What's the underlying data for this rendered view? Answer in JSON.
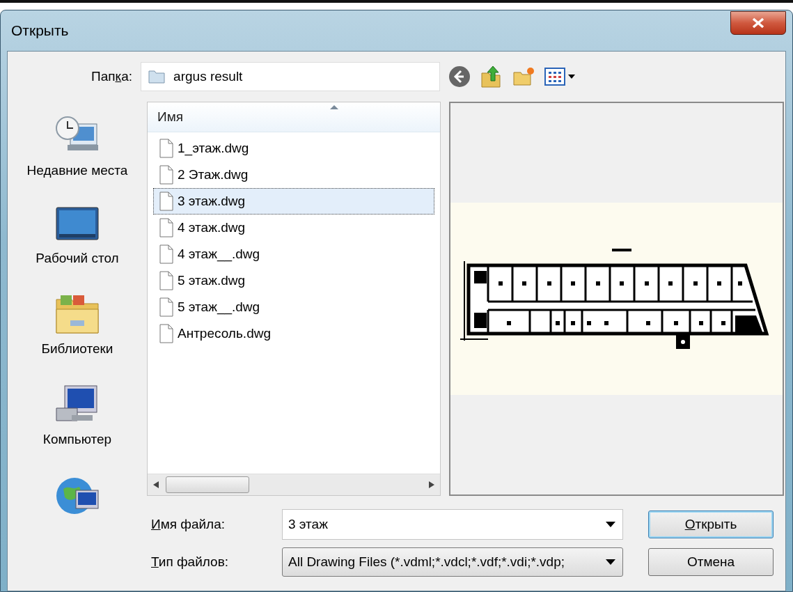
{
  "window": {
    "title": "Открыть"
  },
  "toolbar": {
    "label": "Папка:",
    "folder": "argus result"
  },
  "places": [
    {
      "kind": "recent",
      "label": "Недавние места"
    },
    {
      "kind": "desktop",
      "label": "Рабочий стол"
    },
    {
      "kind": "libraries",
      "label": "Библиотеки"
    },
    {
      "kind": "computer",
      "label": "Компьютер"
    },
    {
      "kind": "network"
    }
  ],
  "file_list": {
    "column": "Имя",
    "files": [
      {
        "name": "1_этаж.dwg",
        "selected": false
      },
      {
        "name": "2 Этаж.dwg",
        "selected": false
      },
      {
        "name": "3 этаж.dwg",
        "selected": true
      },
      {
        "name": "4 этаж.dwg",
        "selected": false
      },
      {
        "name": "4 этаж__.dwg",
        "selected": false
      },
      {
        "name": "5 этаж.dwg",
        "selected": false
      },
      {
        "name": "5 этаж__.dwg",
        "selected": false
      },
      {
        "name": "Антресоль.dwg",
        "selected": false
      }
    ]
  },
  "form": {
    "filename_label": "Имя файла:",
    "filename": "3 этаж",
    "type_label": "Тип файлов:",
    "type": "All Drawing Files (*.vdml;*.vdcl;*.vdf;*.vdi;*.vdp;"
  },
  "buttons": [
    {
      "label": "Открыть",
      "default": true
    },
    {
      "label": "Отмена",
      "default": false
    }
  ]
}
